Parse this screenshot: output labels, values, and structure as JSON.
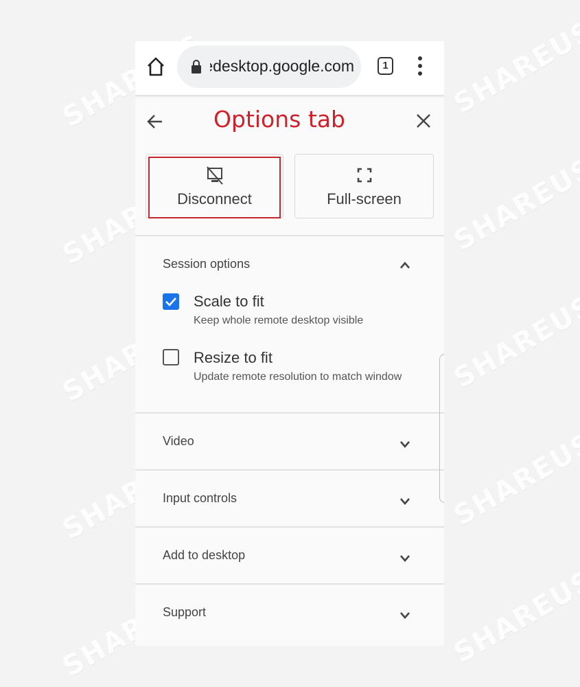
{
  "watermark": "SHAREUS",
  "browser": {
    "url": "remotedesktop.google.com",
    "url_visible": "⊃tedesktop.google.com",
    "tab_count": "1"
  },
  "panel": {
    "title": "Options tab",
    "title_color": "#d0202a",
    "actions": [
      {
        "label": "Disconnect",
        "icon": "monitor-off-icon",
        "highlighted": true
      },
      {
        "label": "Full-screen",
        "icon": "fullscreen-icon",
        "highlighted": false
      }
    ],
    "session_options": {
      "title": "Session options",
      "expanded": true,
      "options": [
        {
          "title": "Scale to fit",
          "description": "Keep whole remote desktop visible",
          "checked": true
        },
        {
          "title": "Resize to fit",
          "description": "Update remote resolution to match window",
          "checked": false
        }
      ]
    },
    "sections": [
      {
        "title": "Video",
        "expanded": false
      },
      {
        "title": "Input controls",
        "expanded": false
      },
      {
        "title": "Add to desktop",
        "expanded": false
      },
      {
        "title": "Support",
        "expanded": false
      }
    ],
    "accent_color": "#1a73e8"
  }
}
